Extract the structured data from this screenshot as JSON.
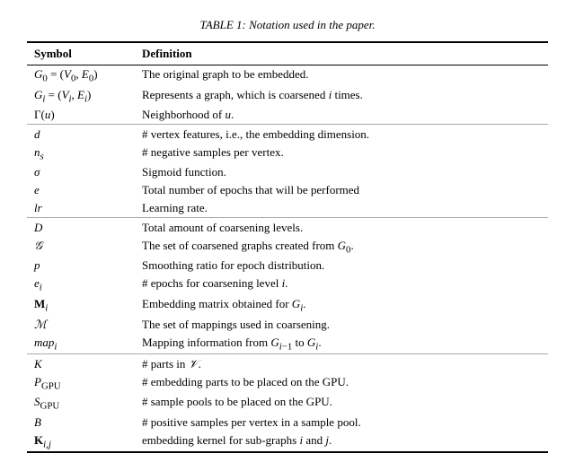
{
  "title": "TABLE 1: Notation used in the paper.",
  "table": {
    "col_symbol": "Symbol",
    "col_def": "Definition",
    "rows": [
      {
        "symbol": "G₀ = (V₀, E₀)",
        "definition": "The original graph to be embedded.",
        "sep": false
      },
      {
        "symbol": "Gᵢ = (Vᵢ, Eᵢ)",
        "definition": "Represents a graph, which is coarsened i times.",
        "sep": false
      },
      {
        "symbol": "Γ(u)",
        "definition": "Neighborhood of u.",
        "sep": false
      },
      {
        "symbol": "d",
        "definition": "# vertex features, i.e., the embedding dimension.",
        "sep": true
      },
      {
        "symbol": "nₛ",
        "definition": "# negative samples per vertex.",
        "sep": false
      },
      {
        "symbol": "σ",
        "definition": "Sigmoid function.",
        "sep": false
      },
      {
        "symbol": "e",
        "definition": "Total number of epochs that will be performed",
        "sep": false
      },
      {
        "symbol": "lr",
        "definition": "Learning rate.",
        "sep": false
      },
      {
        "symbol": "D",
        "definition": "Total amount of coarsening levels.",
        "sep": true
      },
      {
        "symbol": "𝒢",
        "definition": "The set of coarsened graphs created from G₀.",
        "sep": false
      },
      {
        "symbol": "p",
        "definition": "Smoothing ratio for epoch distribution.",
        "sep": false
      },
      {
        "symbol": "eᵢ",
        "definition": "# epochs for coarsening level i.",
        "sep": false
      },
      {
        "symbol": "Mᵢ",
        "definition": "Embedding matrix obtained for Gᵢ.",
        "sep": false,
        "bold_symbol": true
      },
      {
        "symbol": "ℳ",
        "definition": "The set of mappings used in coarsening.",
        "sep": false
      },
      {
        "symbol": "mapᵢ",
        "definition": "Mapping information from Gᵢ₋₁ to Gᵢ.",
        "sep": false
      },
      {
        "symbol": "K",
        "definition": "# parts in 𝒱.",
        "sep": true
      },
      {
        "symbol": "P_GPU",
        "definition": "# embedding parts to be placed on the GPU.",
        "sep": false
      },
      {
        "symbol": "S_GPU",
        "definition": "# sample pools to be placed on the GPU.",
        "sep": false
      },
      {
        "symbol": "B",
        "definition": "# positive samples per vertex in a sample pool.",
        "sep": false
      },
      {
        "symbol": "Kᵢ,ⱼ",
        "definition": "embedding kernel for sub-graphs i and j.",
        "sep": false,
        "bold_symbol": true
      }
    ]
  }
}
